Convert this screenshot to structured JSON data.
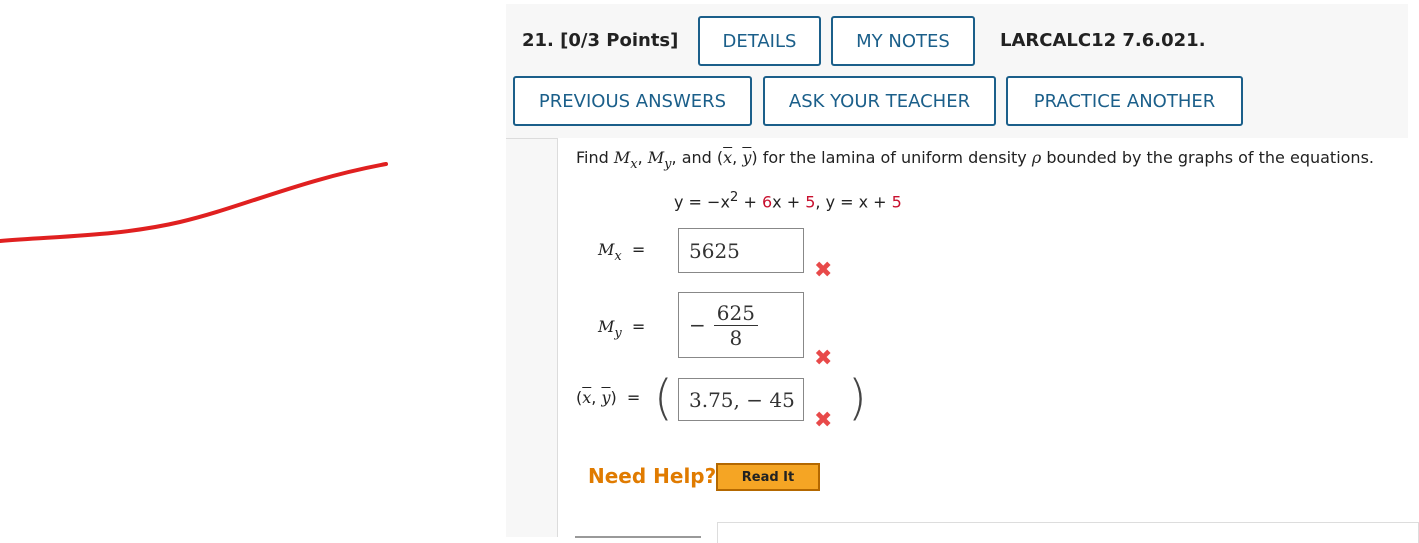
{
  "question": {
    "number_label": "21.",
    "points_label": "[0/3 Points]",
    "reference": "LARCALC12 7.6.021."
  },
  "buttons": {
    "details": "DETAILS",
    "my_notes": "MY NOTES",
    "previous_answers": "PREVIOUS ANSWERS",
    "ask_teacher": "ASK YOUR TEACHER",
    "practice_another": "PRACTICE ANOTHER"
  },
  "problem": {
    "text_find": "Find",
    "text_and": "and",
    "text_rest": "for the lamina of uniform density",
    "text_end": "bounded by the graphs of the equations.",
    "rho": "ρ",
    "equation_part1": "y = −x",
    "equation_exp": "2",
    "equation_plus1": " + ",
    "equation_6": "6",
    "equation_x5": "x + ",
    "equation_5a": "5",
    "equation_mid": ", y = x + ",
    "equation_5b": "5"
  },
  "answers": {
    "mx_label": "M",
    "mx_sub": "x",
    "mx_value": "5625",
    "my_label": "M",
    "my_sub": "y",
    "my_sign": "−",
    "my_num": "625",
    "my_den": "8",
    "centroid_label": "(x, y)",
    "centroid_value": "3.75, − 45",
    "equals": "="
  },
  "help": {
    "need_help": "Need Help?",
    "read_it": "Read It"
  },
  "colors": {
    "button_border": "#1b5f8a",
    "incorrect": "#e84a4a",
    "highlight_number": "#c8102e",
    "help_orange": "#e07b00",
    "readit_bg": "#f5a524",
    "pen_stroke": "#e02020"
  },
  "icons": {
    "incorrect": "x-mark-icon"
  }
}
